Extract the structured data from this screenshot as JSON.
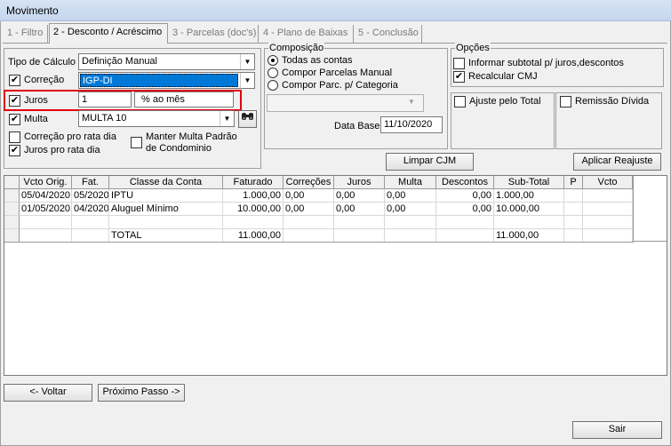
{
  "window": {
    "title": "Movimento"
  },
  "tabs": [
    {
      "label": "1 - Filtro"
    },
    {
      "label": "2 - Desconto / Acréscimo"
    },
    {
      "label": "3 - Parcelas (doc's)"
    },
    {
      "label": "4 - Plano de Baixas"
    },
    {
      "label": "5 - Conclusão"
    }
  ],
  "calc": {
    "tipo_label": "Tipo de Cálculo",
    "tipo_value": "Definição Manual",
    "correcao_label": "Correção",
    "correcao_value": "IGP-DI",
    "juros_label": "Juros",
    "juros_value": "1",
    "juros_unit": "% ao mês",
    "multa_label": "Multa",
    "multa_value": "MULTA 10",
    "prorata_correcao": "Correção pro rata dia",
    "prorata_juros": "Juros pro rata dia",
    "manter_multa": "Manter Multa Padrão de Condominio"
  },
  "composicao": {
    "title": "Composição",
    "opt1": "Todas as contas",
    "opt2": "Compor Parcelas Manual",
    "opt3": "Compor Parc. p/ Categoria",
    "data_base_label": "Data Base",
    "data_base_value": "11/10/2020"
  },
  "opcoes": {
    "title": "Opções",
    "informar": "Informar subtotal p/ juros,descontos",
    "recalcular": "Recalcular CMJ",
    "ajuste": "Ajuste pelo Total",
    "remissao": "Remissão Dívida"
  },
  "buttons": {
    "limpar": "Limpar CJM",
    "aplicar": "Aplicar Reajuste",
    "voltar": "<- Voltar",
    "proximo": "Próximo Passo ->",
    "sair": "Sair"
  },
  "table": {
    "headers": [
      "Vcto Orig.",
      "Fat.",
      "Classe da Conta",
      "Faturado",
      "Correções",
      "Juros",
      "Multa",
      "Descontos",
      "Sub-Total",
      "P",
      "Vcto"
    ],
    "rows": [
      [
        "05/04/2020",
        "05/2020",
        "IPTU",
        "1.000,00",
        "0,00",
        "0,00",
        "0,00",
        "0,00",
        "1.000,00",
        "",
        ""
      ],
      [
        "01/05/2020",
        "04/2020",
        "Aluguel Mínimo",
        "10.000,00",
        "0,00",
        "0,00",
        "0,00",
        "0,00",
        "10.000,00",
        "",
        ""
      ],
      [
        "",
        "",
        "",
        "",
        "",
        "",
        "",
        "",
        "",
        "",
        ""
      ],
      [
        "",
        "",
        "TOTAL",
        "11.000,00",
        "",
        "",
        "",
        "",
        "11.000,00",
        "",
        ""
      ]
    ]
  }
}
